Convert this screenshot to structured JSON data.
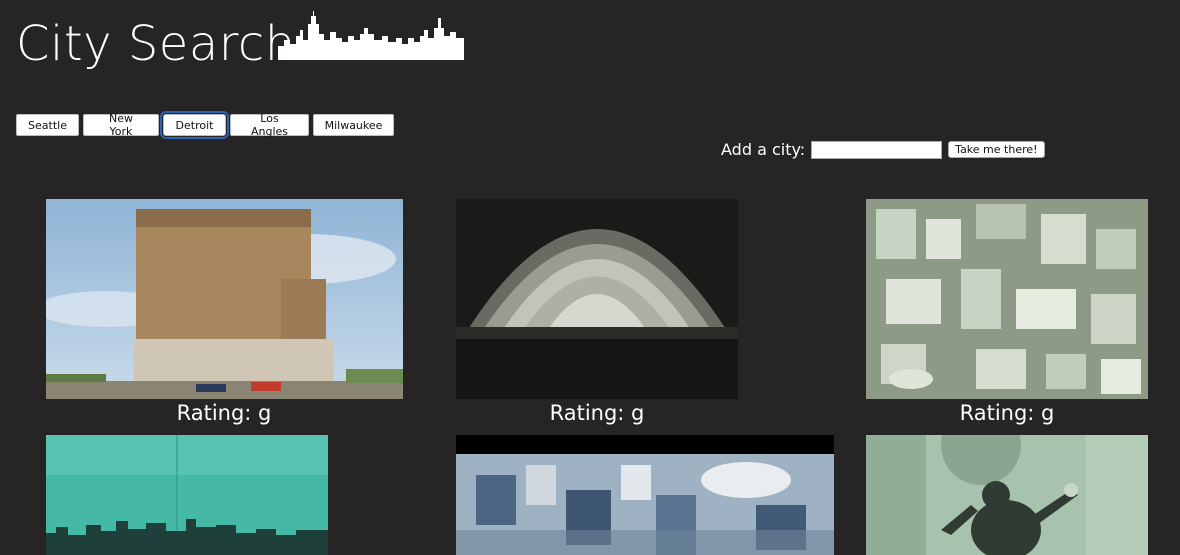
{
  "header": {
    "title": "City Search",
    "logo_icon": "city-skyline-icon"
  },
  "city_buttons": [
    {
      "label": "Seattle",
      "active": false
    },
    {
      "label": "New York",
      "active": false
    },
    {
      "label": "Detroit",
      "active": true
    },
    {
      "label": "Los Angles",
      "active": false
    },
    {
      "label": "Milwaukee",
      "active": false
    }
  ],
  "add_city": {
    "label": "Add a city:",
    "input_value": "",
    "input_placeholder": "",
    "submit_label": "Take me there!"
  },
  "results": [
    {
      "image": "michigan-central-station-photo",
      "rating_text": "Rating: g"
    },
    {
      "image": "orchestra-shell-photo",
      "rating_text": "Rating: g"
    },
    {
      "image": "aerial-city-model-photo",
      "rating_text": "Rating: g"
    },
    {
      "image": "teal-sky-skyline-photo",
      "rating_text": ""
    },
    {
      "image": "aerial-downtown-photo",
      "rating_text": ""
    },
    {
      "image": "spirit-of-detroit-statue-photo",
      "rating_text": ""
    }
  ],
  "colors": {
    "background": "#262425",
    "active_outline": "#2b63b5",
    "text": "#ffffff"
  }
}
